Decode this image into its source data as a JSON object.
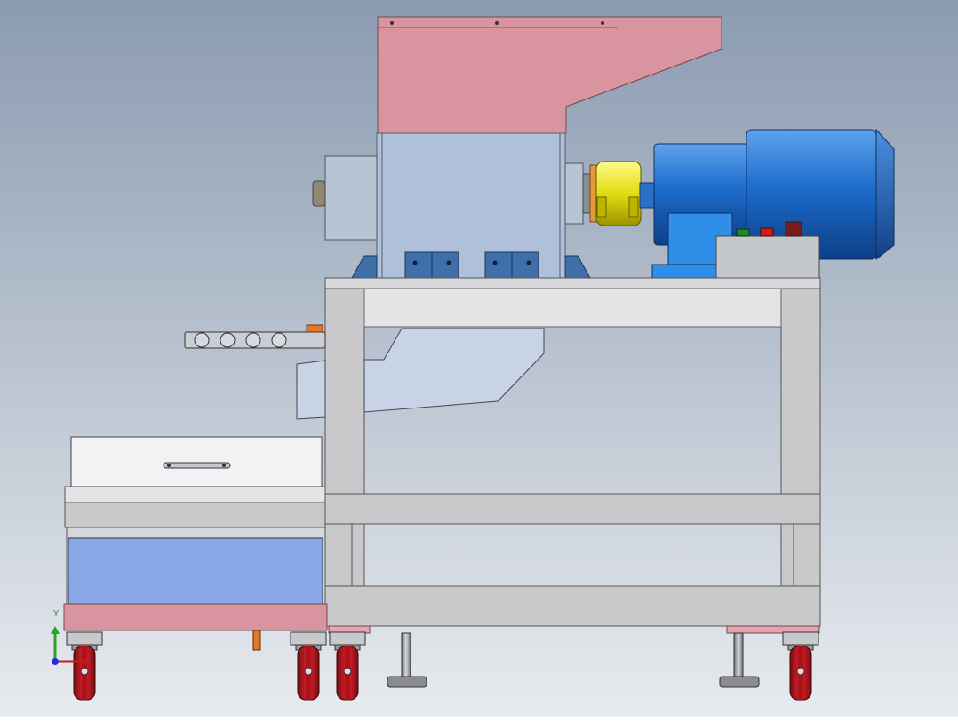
{
  "viewport": {
    "background_top": "#8b9bb1",
    "background_bottom": "#e8ebef"
  },
  "colors": {
    "hopper": "#d9959f",
    "housing": "#aec0da",
    "frame": "#c9c9cc",
    "frame_light": "#e4e4e6",
    "motor_blue": "#1f6fcf",
    "coupling_yellow": "#e8e019",
    "bracket_blue": "#3f6fa8",
    "drawer_blue": "#8aa8e8",
    "wheel_red": "#d21c26",
    "control_box": "#c3c8cc",
    "sheet_steel": "#c8d3e6"
  },
  "triad": {
    "y_label": "Y",
    "x_label": "",
    "y_axis_color": "#2aa22a",
    "x_axis_color": "#c01e1e",
    "z_axis_color": "#2330d0"
  },
  "components": {
    "hopper": "hopper",
    "crusher_housing": "crusher-housing",
    "motor": "electric-motor",
    "coupling": "coupling",
    "control_box": "control-box",
    "frame": "frame",
    "discharge_chute": "discharge-chute",
    "collection_bin": "collection-bin",
    "drawer": "drawer",
    "casters": "casters",
    "leveling_feet": "leveling-feet"
  }
}
